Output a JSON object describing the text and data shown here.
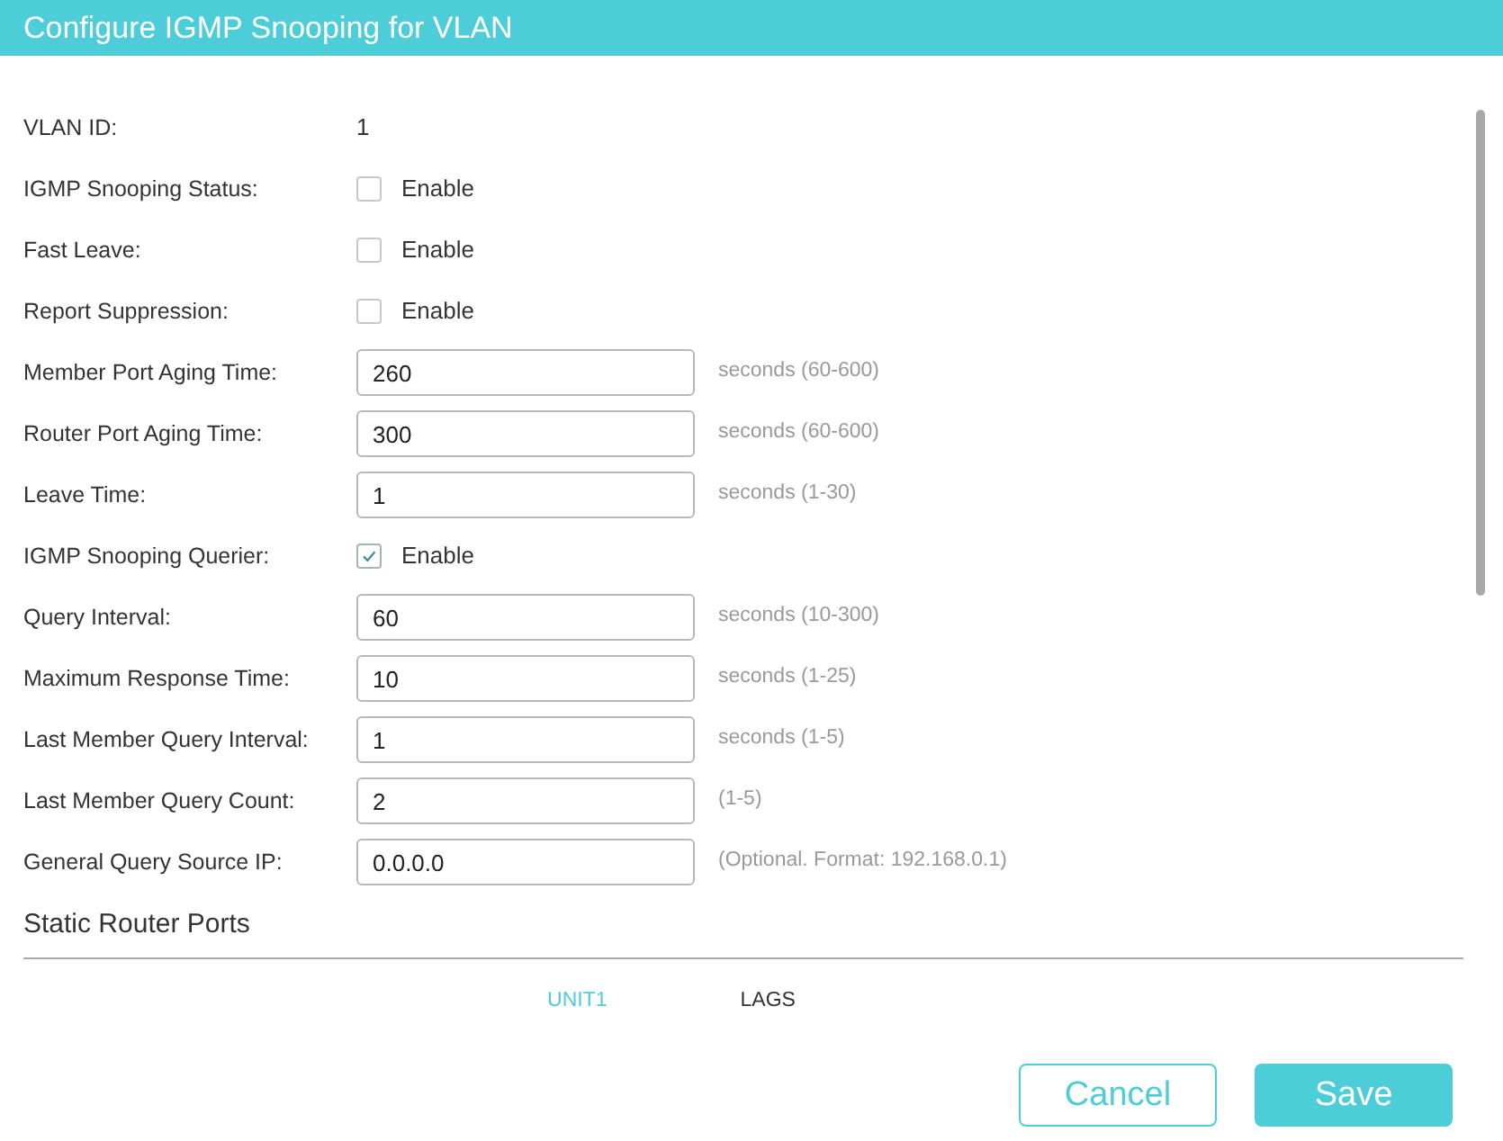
{
  "title": "Configure IGMP Snooping for VLAN",
  "fields": [
    {
      "kind": "text",
      "label": "VLAN ID:",
      "value": "1"
    },
    {
      "kind": "checkbox",
      "label": "IGMP Snooping Status:",
      "option": "Enable",
      "checked": false
    },
    {
      "kind": "checkbox",
      "label": "Fast Leave:",
      "option": "Enable",
      "checked": false
    },
    {
      "kind": "checkbox",
      "label": "Report Suppression:",
      "option": "Enable",
      "checked": false
    },
    {
      "kind": "input",
      "label": "Member Port Aging Time:",
      "value": "260",
      "hint": "seconds (60-600)"
    },
    {
      "kind": "input",
      "label": "Router Port Aging Time:",
      "value": "300",
      "hint": "seconds (60-600)"
    },
    {
      "kind": "input",
      "label": "Leave Time:",
      "value": "1",
      "hint": "seconds (1-30)"
    },
    {
      "kind": "checkbox",
      "label": "IGMP Snooping Querier:",
      "option": "Enable",
      "checked": true
    },
    {
      "kind": "input",
      "label": "Query Interval:",
      "value": "60",
      "hint": "seconds (10-300)"
    },
    {
      "kind": "input",
      "label": "Maximum Response Time:",
      "value": "10",
      "hint": "seconds (1-25)"
    },
    {
      "kind": "input",
      "label": "Last Member Query Interval:",
      "value": "1",
      "hint": "seconds (1-5)"
    },
    {
      "kind": "input",
      "label": "Last Member Query Count:",
      "value": "2",
      "hint": "(1-5)"
    },
    {
      "kind": "input",
      "label": "General Query Source IP:",
      "value": "0.0.0.0",
      "hint": "(Optional. Format: 192.168.0.1)"
    }
  ],
  "section": {
    "title": "Static Router Ports",
    "tabs": [
      {
        "label": "UNIT1",
        "selected": true
      },
      {
        "label": "LAGS",
        "selected": false
      }
    ]
  },
  "buttons": {
    "cancel": "Cancel",
    "save": "Save"
  }
}
